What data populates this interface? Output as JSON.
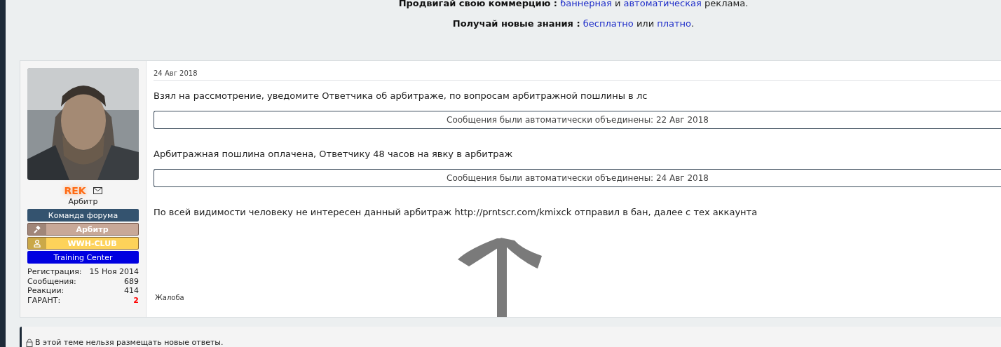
{
  "promo": [
    {
      "label": "Продвигай свою коммерцию :",
      "segments": [
        {
          "kind": "link",
          "text": "баннерная"
        },
        {
          "kind": "text",
          "text": "и"
        },
        {
          "kind": "link",
          "text": "автоматическая"
        },
        {
          "kind": "text",
          "text": "реклама."
        }
      ]
    },
    {
      "label": "Получай новые знания :",
      "segments": [
        {
          "kind": "link",
          "text": "бесплатно"
        },
        {
          "kind": "text",
          "text": "или"
        },
        {
          "kind": "link",
          "text": "платно"
        },
        {
          "kind": "text",
          "text": "."
        }
      ]
    }
  ],
  "post": {
    "user": {
      "name": "REK",
      "title": "Арбитр",
      "banners": [
        {
          "kind": "plain",
          "text": "Команда форума",
          "color": "#34536f"
        },
        {
          "kind": "gavel",
          "text": "Арбитр",
          "color": "#c8a898"
        },
        {
          "kind": "person",
          "text": "WWH-CLUB",
          "color": "#fdd25a"
        },
        {
          "kind": "plain",
          "text": "Training Center",
          "color": "#0000e0"
        }
      ],
      "stats": [
        {
          "label": "Регистрация:",
          "value": "15 Ноя 2014",
          "highlight": false
        },
        {
          "label": "Сообщения:",
          "value": "689",
          "highlight": false
        },
        {
          "label": "Реакции:",
          "value": "414",
          "highlight": false
        },
        {
          "label": "ГАРАНТ:",
          "value": "2",
          "highlight": true
        }
      ]
    },
    "date": "24 Авг 2018",
    "blocks": [
      {
        "kind": "text",
        "text": "Взял на рассмотрение, уведомите Ответчика об арбитраже, по вопросам арбитражной пошлины в лс"
      },
      {
        "kind": "merged",
        "text": "Сообщения были автоматически объединены: 22 Авг 2018"
      },
      {
        "kind": "text",
        "text": "Арбитражная пошлина оплачена, Ответчику 48 часов на явку в арбитраж"
      },
      {
        "kind": "merged",
        "text": "Сообщения были автоматически объединены: 24 Авг 2018"
      },
      {
        "kind": "text",
        "text": "По всей видимости человеку не интересен данный арбитраж http://prntscr.com/kmixck отправил в бан, далее с тех аккаунта"
      }
    ],
    "report": "Жалоба"
  },
  "notice": "В этой теме нельзя размещать новые ответы."
}
